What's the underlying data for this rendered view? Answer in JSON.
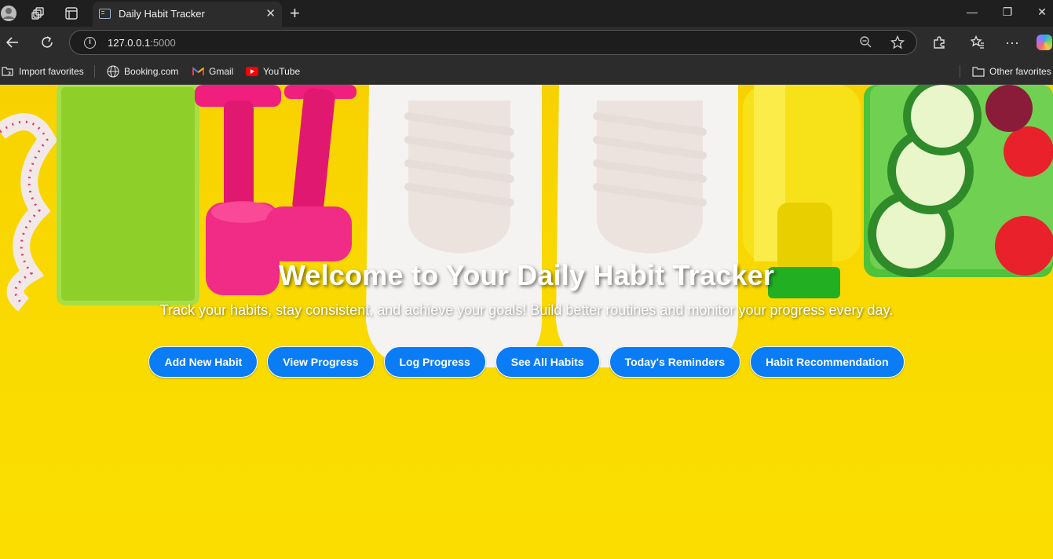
{
  "browser": {
    "tab_title": "Daily Habit Tracker",
    "url_host": "127.0.0.1",
    "url_port": ":5000",
    "bookmarks": [
      "Import favorites",
      "Booking.com",
      "Gmail",
      "YouTube"
    ],
    "other_favorites": "Other favorites"
  },
  "hero": {
    "title": "Welcome to Your Daily Habit Tracker",
    "subtitle": "Track your habits, stay consistent, and achieve your goals! Build better routines and monitor your progress every day."
  },
  "buttons": [
    "Add New Habit",
    "View Progress",
    "Log Progress",
    "See All Habits",
    "Today's Reminders",
    "Habit Recommendation"
  ],
  "colors": {
    "page_background": "#fadb00",
    "button_background": "#0a7cf5",
    "button_text": "#ffffff",
    "chrome_dark": "#1f1f1f"
  },
  "icons": [
    "profile-icon",
    "workspaces-icon",
    "tab-actions-icon",
    "back-arrow-icon",
    "reload-icon",
    "info-icon",
    "zoom-icon",
    "star-icon",
    "extensions-icon",
    "favorites-icon",
    "more-icon",
    "folder-icon"
  ]
}
